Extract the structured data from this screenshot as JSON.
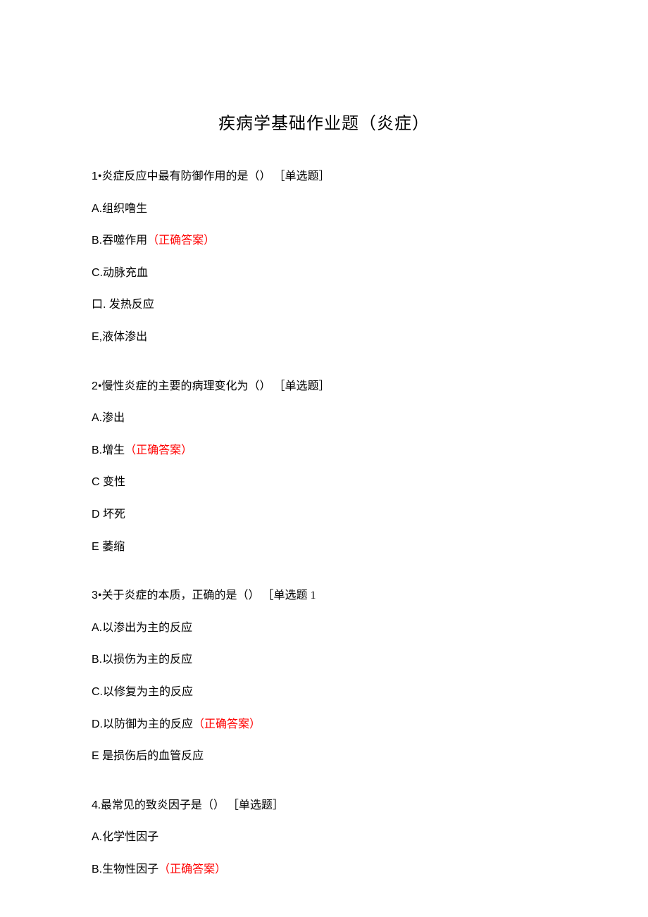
{
  "title": "疾病学基础作业题（炎症）",
  "correct_label": "（正确答案）",
  "questions": [
    {
      "num": "1",
      "sep": "•",
      "text": "炎症反应中最有防御作用的是（） ［单选题］",
      "options": [
        {
          "label": "A.",
          "text": "组织噜生",
          "correct": false
        },
        {
          "label": "B.",
          "text": "吞噬作用",
          "correct": true
        },
        {
          "label": "C.",
          "text": "动脉充血",
          "correct": false
        },
        {
          "label": "口. ",
          "text": "发热反应",
          "correct": false
        },
        {
          "label": "E,",
          "text": "液体渗出",
          "correct": false
        }
      ]
    },
    {
      "num": "2",
      "sep": "•",
      "text": "慢性炎症的主要的病理变化为（） ［单选题］",
      "options": [
        {
          "label": "A.",
          "text": "渗出",
          "correct": false
        },
        {
          "label": "B.",
          "text": "增生",
          "correct": true
        },
        {
          "label": "C ",
          "text": "变性",
          "correct": false
        },
        {
          "label": "D ",
          "text": "坏死",
          "correct": false
        },
        {
          "label": "E ",
          "text": "萎缩",
          "correct": false
        }
      ]
    },
    {
      "num": "3",
      "sep": "•",
      "text": "关于炎症的本质，正确的是（） ［单选题 1",
      "options": [
        {
          "label": "A.",
          "text": "以渗出为主的反应",
          "correct": false
        },
        {
          "label": "B.",
          "text": "以损伤为主的反应",
          "correct": false
        },
        {
          "label": "C.",
          "text": "以修复为主的反应",
          "correct": false
        },
        {
          "label": "D.",
          "text": "以防御为主的反应",
          "correct": true
        },
        {
          "label": "E ",
          "text": "是损伤后的血管反应",
          "correct": false
        }
      ]
    },
    {
      "num": "4",
      "sep": ".",
      "text": "最常见的致炎因子是（） ［单选题］",
      "options": [
        {
          "label": "A.",
          "text": "化学性因子",
          "correct": false
        },
        {
          "label": "B.",
          "text": "生物性因子",
          "correct": true
        }
      ]
    }
  ]
}
